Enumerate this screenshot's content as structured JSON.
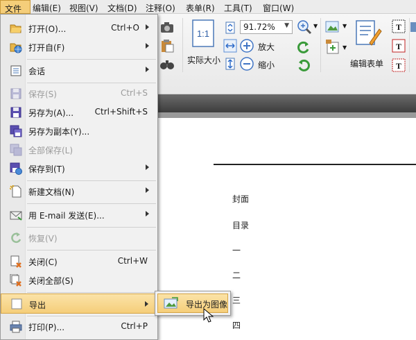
{
  "menubar": {
    "items": [
      "文件",
      "编辑(E)",
      "视图(V)",
      "文档(D)",
      "注释(O)",
      "表单(R)",
      "工具(T)",
      "窗口(W)"
    ]
  },
  "ribbon": {
    "zoom_value": "91.72%",
    "actual_size_label": "实际大小",
    "zoom_in_label": "放大",
    "zoom_out_label": "缩小",
    "edit_form_label": "编辑表单"
  },
  "file_menu": {
    "items": [
      {
        "label": "打开(O)...",
        "shortcut": "Ctrl+O",
        "submenu": true,
        "icon": "open-folder-icon"
      },
      {
        "label": "打开自(F)",
        "shortcut": "",
        "submenu": true,
        "icon": "open-from-icon"
      },
      {
        "label": "会话",
        "shortcut": "",
        "submenu": true,
        "icon": "session-icon"
      },
      {
        "label": "保存(S)",
        "shortcut": "Ctrl+S",
        "submenu": false,
        "icon": "save-icon",
        "disabled": true
      },
      {
        "label": "另存为(A)...",
        "shortcut": "Ctrl+Shift+S",
        "submenu": false,
        "icon": "save-as-icon"
      },
      {
        "label": "另存为副本(Y)...",
        "shortcut": "",
        "submenu": false,
        "icon": "save-copy-icon"
      },
      {
        "label": "全部保存(L)",
        "shortcut": "",
        "submenu": false,
        "icon": "save-all-icon",
        "disabled": true
      },
      {
        "label": "保存到(T)",
        "shortcut": "",
        "submenu": true,
        "icon": "save-to-icon"
      },
      {
        "label": "新建文档(N)",
        "shortcut": "",
        "submenu": true,
        "icon": "new-document-icon"
      },
      {
        "label": "用 E-mail 发送(E)...",
        "shortcut": "",
        "submenu": true,
        "icon": "email-icon"
      },
      {
        "label": "恢复(V)",
        "shortcut": "",
        "submenu": false,
        "icon": "revert-icon",
        "disabled": true
      },
      {
        "label": "关闭(C)",
        "shortcut": "Ctrl+W",
        "submenu": false,
        "icon": "close-document-icon"
      },
      {
        "label": "关闭全部(S)",
        "shortcut": "",
        "submenu": false,
        "icon": "close-all-icon"
      },
      {
        "label": "导出",
        "shortcut": "",
        "submenu": true,
        "icon": "export-icon",
        "highlighted": true
      },
      {
        "label": "打印(P)...",
        "shortcut": "Ctrl+P",
        "submenu": false,
        "icon": "print-icon"
      }
    ]
  },
  "export_submenu": {
    "item_label": "导出为图像",
    "icon": "export-image-icon"
  },
  "document": {
    "toc": [
      "封面",
      "目录",
      "一",
      "二",
      "三",
      "四"
    ]
  },
  "colors": {
    "highlight": "#f5ce7a",
    "highlight_border": "#d4a445",
    "menu_bg": "#f1f1f1",
    "dark_strip": "#4a4a4a"
  }
}
